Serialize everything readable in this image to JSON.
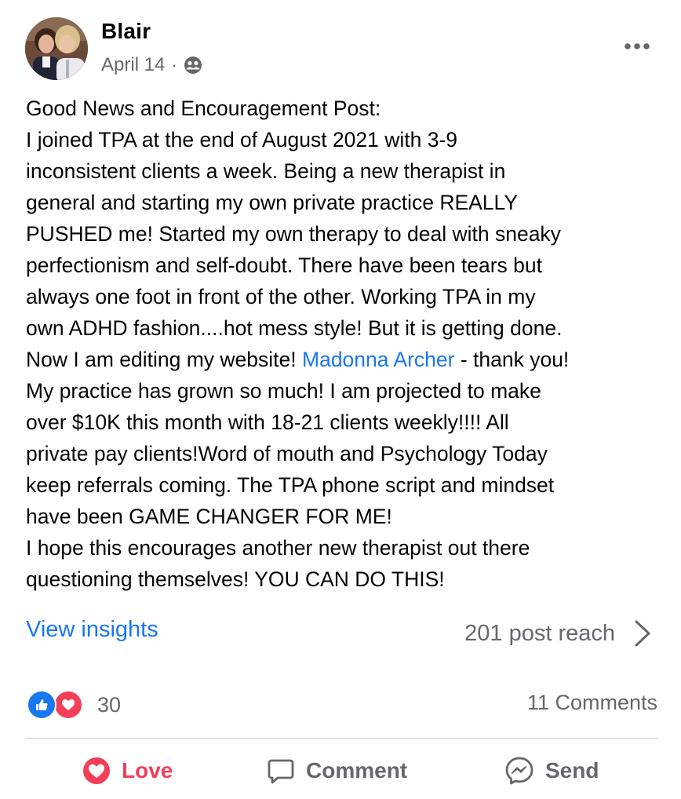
{
  "post": {
    "author": "Blair",
    "date": "April 14",
    "separator": "·",
    "audience_icon": "friends-icon",
    "more_icon": "more-horizontal-icon",
    "text_lines": [
      "Good News and Encouragement Post:",
      "I joined TPA at the end of August 2021 with 3-9",
      "inconsistent clients a week. Being a new therapist in",
      "general and starting my own private practice REALLY",
      "PUSHED me! Started my own therapy to deal with sneaky",
      "perfectionism and self-doubt. There have been tears but",
      "always one foot in front of the other. Working TPA in my",
      "own ADHD fashion....hot mess style! But it is getting done."
    ],
    "mention_line": {
      "before": "Now I am editing my website! ",
      "mention": "Madonna Archer",
      "after": " - thank you!"
    },
    "text_lines_after": [
      "My practice has grown so much! I am projected to make",
      "over $10K this month with 18-21 clients weekly!!!! All",
      "private pay clients!Word of mouth and Psychology Today",
      "keep referrals coming. The TPA phone script and mindset",
      "have been GAME CHANGER FOR ME!",
      "I hope this encourages another new therapist out there",
      "questioning themselves! YOU CAN DO THIS!"
    ]
  },
  "insights": {
    "link_label": "View insights",
    "reach_label": "201 post reach"
  },
  "engagement": {
    "reaction_count": "30",
    "comments_label": "11 Comments",
    "reaction_icons": [
      "like-icon",
      "love-icon"
    ]
  },
  "actions": {
    "love_label": "Love",
    "comment_label": "Comment",
    "send_label": "Send"
  },
  "colors": {
    "accent_blue": "#1877f2",
    "love_red": "#f33e58",
    "secondary_text": "#65676b",
    "divider": "#ced0d4"
  }
}
